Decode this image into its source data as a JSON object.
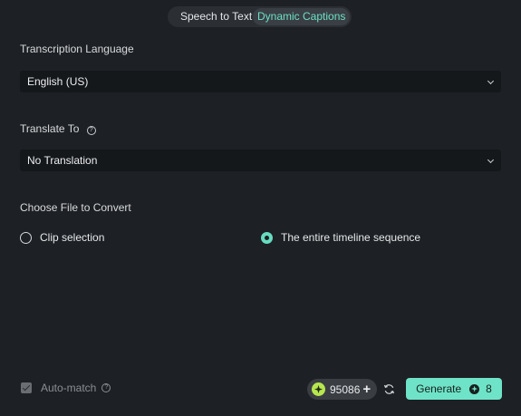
{
  "tabs": [
    {
      "label": "Speech to Text",
      "active": false
    },
    {
      "label": "Dynamic Captions",
      "active": true
    }
  ],
  "transcription": {
    "label": "Transcription Language",
    "value": "English (US)"
  },
  "translate": {
    "label": "Translate To",
    "value": "No Translation"
  },
  "file": {
    "label": "Choose File to Convert",
    "options": [
      {
        "label": "Clip selection",
        "selected": false
      },
      {
        "label": "The entire timeline sequence",
        "selected": true
      }
    ]
  },
  "footer": {
    "automatch_label": "Auto-match",
    "automatch_checked": true,
    "credits": "95086",
    "generate_label": "Generate",
    "generate_cost": "8"
  },
  "icons": {
    "help": "question-circle-icon",
    "chevron": "chevron-down-icon",
    "coin": "credit-coin-icon",
    "plus": "plus-icon",
    "refresh": "refresh-icon"
  },
  "colors": {
    "background": "#1d2024",
    "accent": "#6fe3c7",
    "field": "#15181b"
  }
}
